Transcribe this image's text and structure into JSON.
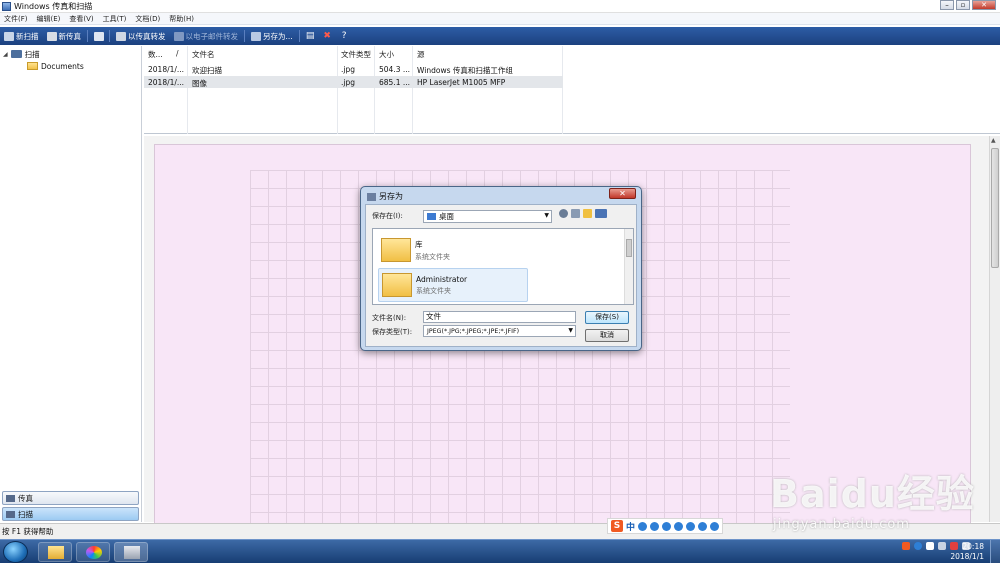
{
  "window": {
    "title": "Windows 传真和扫描"
  },
  "menu": [
    "文件(F)",
    "编辑(E)",
    "查看(V)",
    "工具(T)",
    "文档(D)",
    "帮助(H)"
  ],
  "toolbar": {
    "new_scan": "新扫描",
    "new_fax": "新传真",
    "forward_fax": "以传真转发",
    "forward_email": "以电子邮件转发",
    "save_as": "另存为..."
  },
  "nav": {
    "tree_root": "扫描",
    "tree_child": "Documents",
    "fax_button": "传真",
    "scan_button": "扫描"
  },
  "list": {
    "headers": [
      "数...",
      "/",
      "文件名",
      "文件类型",
      "大小",
      "源"
    ],
    "rows": [
      {
        "date": "2018/1/...",
        "name": "欢迎扫描",
        "type": ".jpg",
        "size": "504.3 ...",
        "source": "Windows 传真和扫描工作组"
      },
      {
        "date": "2018/1/...",
        "name": "图像",
        "type": ".jpg",
        "size": "685.1 ...",
        "source": "HP LaserJet M1005 MFP"
      }
    ]
  },
  "dialog": {
    "title": "另存为",
    "close": "✕",
    "save_in_label": "保存在(I):",
    "save_in_value": "桌面",
    "items": [
      {
        "name": "库",
        "sub": "系统文件夹"
      },
      {
        "name": "Administrator",
        "sub": "系统文件夹"
      }
    ],
    "filename_label": "文件名(N):",
    "filename_value": "文件",
    "filetype_label": "保存类型(T):",
    "filetype_value": "JPEG(*.JPG;*.JPEG;*.JPE;*.JFIF)",
    "save_button": "保存(S)",
    "cancel_button": "取消"
  },
  "statusbar": {
    "text": "按 F1 获得帮助"
  },
  "ime": {
    "mode": "中"
  },
  "watermark": {
    "brand": "Baidu经验",
    "url": "jingyan.baidu.com"
  },
  "taskbar": {
    "time": "20:18",
    "date": "2018/1/1"
  },
  "colors": {
    "toolbar": "#1c417f",
    "page_tint": "#f8e6f7",
    "dialog_frame": "#c6d8ee"
  }
}
